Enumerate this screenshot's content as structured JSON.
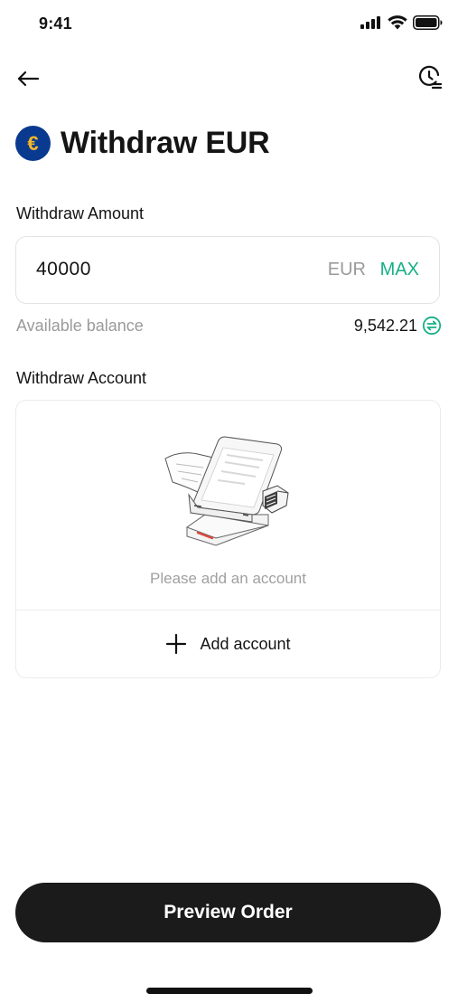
{
  "status_bar": {
    "time": "9:41",
    "icons": [
      "signal-icon",
      "wifi-icon",
      "battery-icon"
    ]
  },
  "nav": {
    "back_icon": "back-arrow-icon",
    "history_icon": "history-icon"
  },
  "header": {
    "coin_symbol": "€",
    "title": "Withdraw EUR",
    "coin_color": "#0a3a8f",
    "coin_symbol_color": "#f5b62a"
  },
  "amount": {
    "label": "Withdraw Amount",
    "value": "40000",
    "currency": "EUR",
    "max_label": "MAX",
    "accent_color": "#17b085"
  },
  "balance": {
    "label": "Available balance",
    "value": "9,542.21",
    "icon": "swap-circle-icon"
  },
  "account": {
    "label": "Withdraw Account",
    "empty_text": "Please add an account",
    "illustration": "wallet-illustration",
    "add_icon": "plus-icon",
    "add_label": "Add account"
  },
  "footer": {
    "preview_label": "Preview Order"
  }
}
